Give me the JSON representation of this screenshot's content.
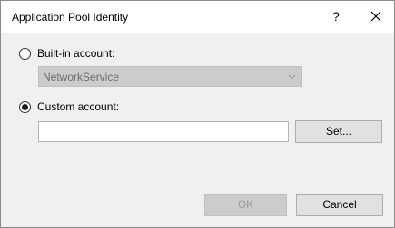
{
  "window": {
    "title": "Application Pool Identity",
    "help_glyph": "?"
  },
  "builtin": {
    "label": "Built-in account:",
    "selected": false,
    "combo_value": "NetworkService"
  },
  "custom": {
    "label": "Custom account:",
    "selected": true,
    "field_value": "",
    "set_button": "Set..."
  },
  "footer": {
    "ok_label": "OK",
    "cancel_label": "Cancel"
  }
}
